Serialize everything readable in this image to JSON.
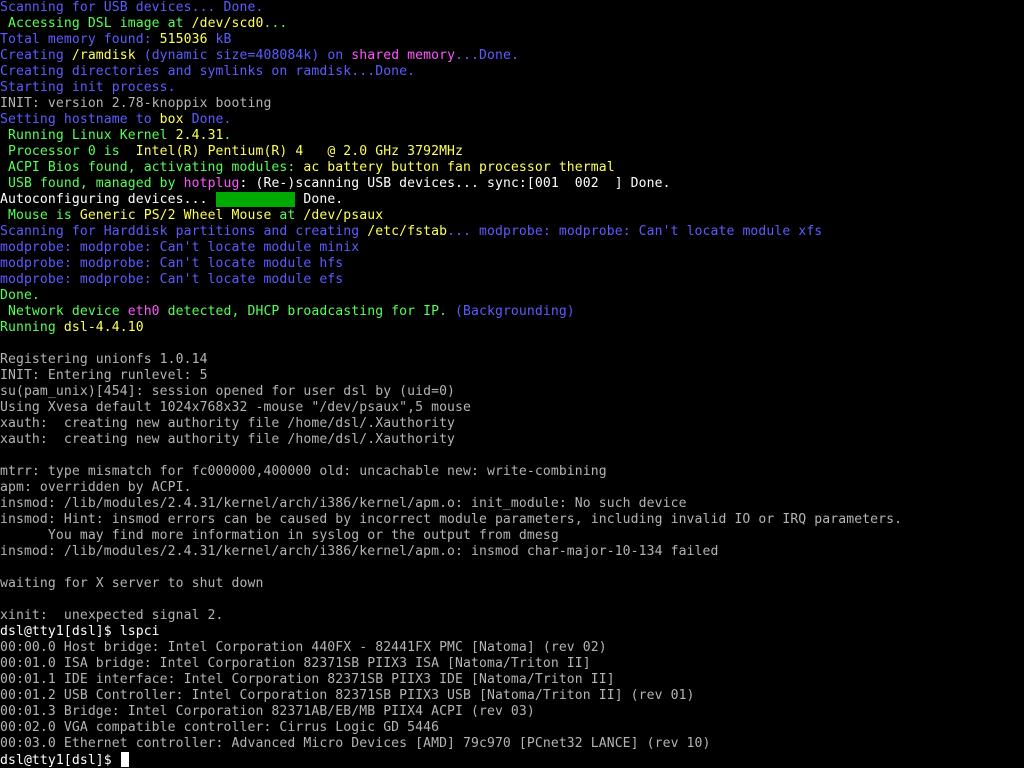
{
  "palette": {
    "white": "#ffffff",
    "gray": "#b4b4b4",
    "blue": "#5c5cff",
    "yellow": "#ffff55",
    "green": "#55ff55",
    "magenta": "#ff55ff",
    "dkgreen": "#00aa00"
  },
  "console": {
    "lines": [
      [
        [
          "Scanning for USB devices... Done.",
          "blue"
        ]
      ],
      [
        [
          " Accessing DSL image at ",
          "green"
        ],
        [
          "/dev/scd0",
          "yellow"
        ],
        [
          "...",
          "green"
        ]
      ],
      [
        [
          "Total memory found: ",
          "blue"
        ],
        [
          "515036",
          "yellow"
        ],
        [
          " kB",
          "blue"
        ]
      ],
      [
        [
          "Creating ",
          "blue"
        ],
        [
          "/ramdisk",
          "yellow"
        ],
        [
          " (dynamic size=408084k) on ",
          "blue"
        ],
        [
          "shared memory",
          "magenta"
        ],
        [
          "...Done.",
          "blue"
        ]
      ],
      [
        [
          "Creating directories and symlinks on ramdisk...Done.",
          "blue"
        ]
      ],
      [
        [
          "Starting init process.",
          "blue"
        ]
      ],
      [
        [
          "INIT: version 2.78-knoppix booting",
          "gray"
        ]
      ],
      [
        [
          "Setting hostname to ",
          "blue"
        ],
        [
          "box",
          "yellow"
        ],
        [
          " Done.",
          "blue"
        ]
      ],
      [
        [
          " Running Linux Kernel ",
          "green"
        ],
        [
          "2.4.31",
          "yellow"
        ],
        [
          ".",
          "green"
        ]
      ],
      [
        [
          " Processor 0 is  ",
          "green"
        ],
        [
          "Intel(R) Pentium(R) 4   @ 2.0 GHz 3792MHz",
          "yellow"
        ]
      ],
      [
        [
          " ACPI Bios found, activating modules: ",
          "green"
        ],
        [
          "ac battery button fan processor thermal",
          "yellow"
        ]
      ],
      [
        [
          " USB found, managed by ",
          "green"
        ],
        [
          "hotplug",
          "magenta"
        ],
        [
          ": (Re-)scanning USB devices... sync:[001  002  ] Done.",
          "white"
        ]
      ],
      [
        [
          "Autoconfiguring devices... ",
          "white"
        ],
        [
          "BAR",
          "bar"
        ],
        [
          " Done.",
          "white"
        ]
      ],
      [
        [
          " Mouse is ",
          "green"
        ],
        [
          "Generic PS/2 Wheel Mouse",
          "yellow"
        ],
        [
          " at ",
          "green"
        ],
        [
          "/dev/psaux",
          "yellow"
        ]
      ],
      [
        [
          "Scanning for Harddisk partitions and creating ",
          "blue"
        ],
        [
          "/etc/fstab",
          "yellow"
        ],
        [
          "... modprobe: modprobe: Can't locate module xfs",
          "blue"
        ]
      ],
      [
        [
          "modprobe: modprobe: Can't locate module minix",
          "blue"
        ]
      ],
      [
        [
          "modprobe: modprobe: Can't locate module hfs",
          "blue"
        ]
      ],
      [
        [
          "modprobe: modprobe: Can't locate module efs",
          "blue"
        ]
      ],
      [
        [
          "Done.",
          "green"
        ]
      ],
      [
        [
          " Network device ",
          "green"
        ],
        [
          "eth0",
          "magenta"
        ],
        [
          " detected, DHCP broadcasting for IP. ",
          "green"
        ],
        [
          "(Backgrounding)",
          "blue"
        ]
      ],
      [
        [
          "Running ",
          "green"
        ],
        [
          "dsl-4.4.10",
          "yellow"
        ]
      ],
      [
        [
          "",
          "gray"
        ]
      ],
      [
        [
          "Registering unionfs 1.0.14",
          "gray"
        ]
      ],
      [
        [
          "INIT: Entering runlevel: 5",
          "gray"
        ]
      ],
      [
        [
          "su(pam_unix)[454]: session opened for user dsl by (uid=0)",
          "gray"
        ]
      ],
      [
        [
          "Using Xvesa default 1024x768x32 -mouse \"/dev/psaux\",5 mouse",
          "gray"
        ]
      ],
      [
        [
          "xauth:  creating new authority file /home/dsl/.Xauthority",
          "gray"
        ]
      ],
      [
        [
          "xauth:  creating new authority file /home/dsl/.Xauthority",
          "gray"
        ]
      ],
      [
        [
          "",
          "gray"
        ]
      ],
      [
        [
          "mtrr: type mismatch for fc000000,400000 old: uncachable new: write-combining",
          "gray"
        ]
      ],
      [
        [
          "apm: overridden by ACPI.",
          "gray"
        ]
      ],
      [
        [
          "insmod: /lib/modules/2.4.31/kernel/arch/i386/kernel/apm.o: init_module: No such device",
          "gray"
        ]
      ],
      [
        [
          "insmod: Hint: insmod errors can be caused by incorrect module parameters, including invalid IO or IRQ parameters.",
          "gray"
        ]
      ],
      [
        [
          "      You may find more information in syslog or the output from dmesg",
          "gray"
        ]
      ],
      [
        [
          "insmod: /lib/modules/2.4.31/kernel/arch/i386/kernel/apm.o: insmod char-major-10-134 failed",
          "gray"
        ]
      ],
      [
        [
          "",
          "gray"
        ]
      ],
      [
        [
          "waiting for X server to shut down",
          "gray"
        ]
      ],
      [
        [
          "",
          "gray"
        ]
      ],
      [
        [
          "xinit:  unexpected signal 2.",
          "gray"
        ]
      ],
      [
        [
          "dsl@tty1[dsl]$ lspci",
          "white"
        ]
      ],
      [
        [
          "00:00.0 Host bridge: Intel Corporation 440FX - 82441FX PMC [Natoma] (rev 02)",
          "gray"
        ]
      ],
      [
        [
          "00:01.0 ISA bridge: Intel Corporation 82371SB PIIX3 ISA [Natoma/Triton II]",
          "gray"
        ]
      ],
      [
        [
          "00:01.1 IDE interface: Intel Corporation 82371SB PIIX3 IDE [Natoma/Triton II]",
          "gray"
        ]
      ],
      [
        [
          "00:01.2 USB Controller: Intel Corporation 82371SB PIIX3 USB [Natoma/Triton II] (rev 01)",
          "gray"
        ]
      ],
      [
        [
          "00:01.3 Bridge: Intel Corporation 82371AB/EB/MB PIIX4 ACPI (rev 03)",
          "gray"
        ]
      ],
      [
        [
          "00:02.0 VGA compatible controller: Cirrus Logic GD 5446",
          "gray"
        ]
      ],
      [
        [
          "00:03.0 Ethernet controller: Advanced Micro Devices [AMD] 79c970 [PCnet32 LANCE] (rev 10)",
          "gray"
        ]
      ],
      [
        [
          "dsl@tty1[dsl]$ ",
          "white"
        ],
        [
          "CURSOR",
          "cursor"
        ]
      ]
    ]
  }
}
